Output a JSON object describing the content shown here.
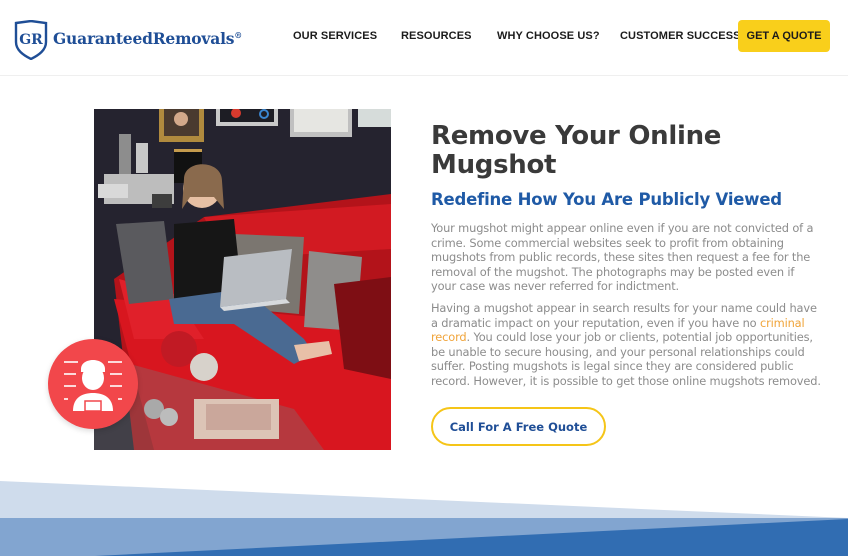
{
  "header": {
    "logo_text": "GuaranteedRemovals",
    "logo_monogram": "GR",
    "logo_registered": "®",
    "nav": [
      {
        "label": "OUR SERVICES"
      },
      {
        "label": "RESOURCES"
      },
      {
        "label": "WHY CHOOSE US?"
      },
      {
        "label": "CUSTOMER SUCCESS"
      }
    ],
    "cta_label": "GET A QUOTE"
  },
  "hero": {
    "image_alt": "Woman using a laptop on a red sofa",
    "badge_icon": "mugshot-person-icon",
    "title_line1": "Remove Your Online",
    "title_line2": "Mugshot",
    "subtitle": "Redefine How You Are Publicly Viewed",
    "paragraph1": "Your mugshot might appear online even if you are not convicted of a crime. Some commercial websites seek to profit from obtaining mugshots from public records, these sites then request a fee for the removal of the mugshot. The photographs may be posted even if your case was never referred for indictment.",
    "paragraph2_before": "Having a mugshot appear in search results for your name could have a dramatic impact on your reputation, even if you have no ",
    "paragraph2_link": "criminal record",
    "paragraph2_after": ". You could lose your job or clients, potential job opportunities, be unable to secure housing, and your personal relationships could suffer. Posting mugshots is legal since they are considered public record. However, it is possible to get those online mugshots removed.",
    "cta_label": "Call For A Free Quote"
  },
  "colors": {
    "brand_blue": "#1f4e96",
    "subtitle_blue": "#1f5aa6",
    "accent_yellow": "#f9cf1b",
    "badge_red": "#f2474b",
    "link_orange": "#f0a43a",
    "wave_light": "#cfdcec",
    "wave_mid": "#82a5d0",
    "wave_dark": "#316db2"
  }
}
